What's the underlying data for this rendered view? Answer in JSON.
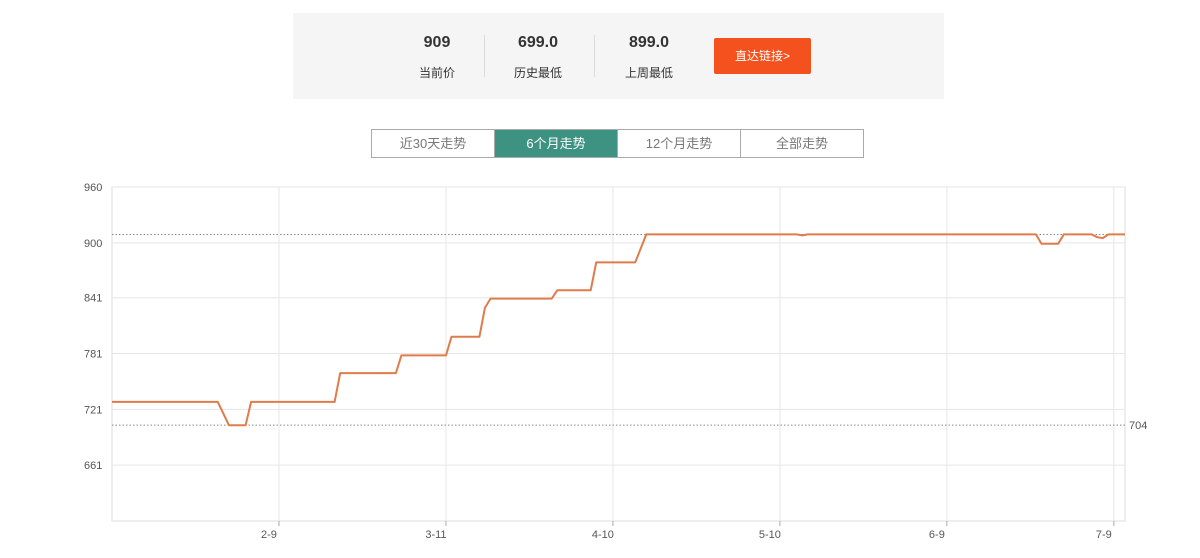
{
  "summary": {
    "current_price": "909",
    "current_label": "当前价",
    "history_low": "699.0",
    "history_low_label": "历史最低",
    "last_week_low": "899.0",
    "last_week_low_label": "上周最低",
    "direct_link_label": "直达链接>"
  },
  "tabs": [
    {
      "label": "近30天走势",
      "active": false
    },
    {
      "label": "6个月走势",
      "active": true
    },
    {
      "label": "12个月走势",
      "active": false
    },
    {
      "label": "全部走势",
      "active": false
    }
  ],
  "colors": {
    "line": "#e07b4a",
    "active_tab": "#3e9282",
    "button": "#f4511e"
  },
  "chart_data": {
    "type": "line",
    "title": "",
    "xlabel": "",
    "ylabel": "",
    "ylim": [
      601,
      960
    ],
    "xlim": [
      0,
      182
    ],
    "y_ticks": [
      "661",
      "721",
      "781",
      "841",
      "900",
      "960"
    ],
    "x_ticks": [
      {
        "label": "2-9",
        "x": 30
      },
      {
        "label": "3-11",
        "x": 60
      },
      {
        "label": "4-10",
        "x": 90
      },
      {
        "label": "5-10",
        "x": 120
      },
      {
        "label": "6-9",
        "x": 150
      },
      {
        "label": "7-9",
        "x": 180
      }
    ],
    "reference_lines": [
      {
        "value": 909,
        "label": ""
      },
      {
        "value": 704,
        "label": "704"
      }
    ],
    "grid": true,
    "series": [
      {
        "x": [
          0,
          19,
          21,
          24,
          25,
          40,
          41,
          51,
          52,
          60,
          61,
          66,
          67,
          68,
          69,
          79,
          80,
          86,
          87,
          91,
          92,
          94,
          96,
          123,
          124,
          125,
          126,
          166,
          167,
          170,
          171,
          176,
          177,
          178,
          179,
          182
        ],
        "values": [
          729,
          729,
          704,
          704,
          729,
          729,
          760,
          760,
          779,
          779,
          799,
          799,
          830,
          840,
          840,
          840,
          849,
          849,
          879,
          879,
          879,
          879,
          909,
          909,
          908,
          909,
          909,
          909,
          899,
          899,
          909,
          909,
          906,
          905,
          909,
          909
        ]
      }
    ]
  }
}
